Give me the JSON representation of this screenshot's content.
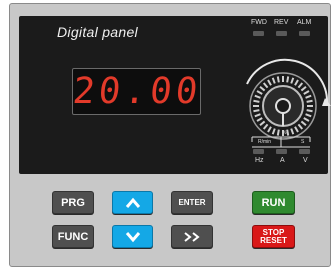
{
  "panel": {
    "title": "Digital panel",
    "indicators": [
      "FWD",
      "REV",
      "ALM"
    ],
    "display_value": "20.00",
    "units": [
      "Hz",
      "A",
      "V"
    ],
    "unit_sub_left": "R/min",
    "unit_sub_right": "S",
    "unit_sub_mid": "%"
  },
  "keys": {
    "prg": "PRG",
    "enter": "ENTER",
    "run": "RUN",
    "func": "FUNC",
    "stop": "STOP",
    "reset": "RESET"
  },
  "colors": {
    "display_digits": "#e23a2a",
    "arrow_keys": "#14a8e6",
    "run_key": "#2f8a2f",
    "stop_key": "#d91818"
  }
}
